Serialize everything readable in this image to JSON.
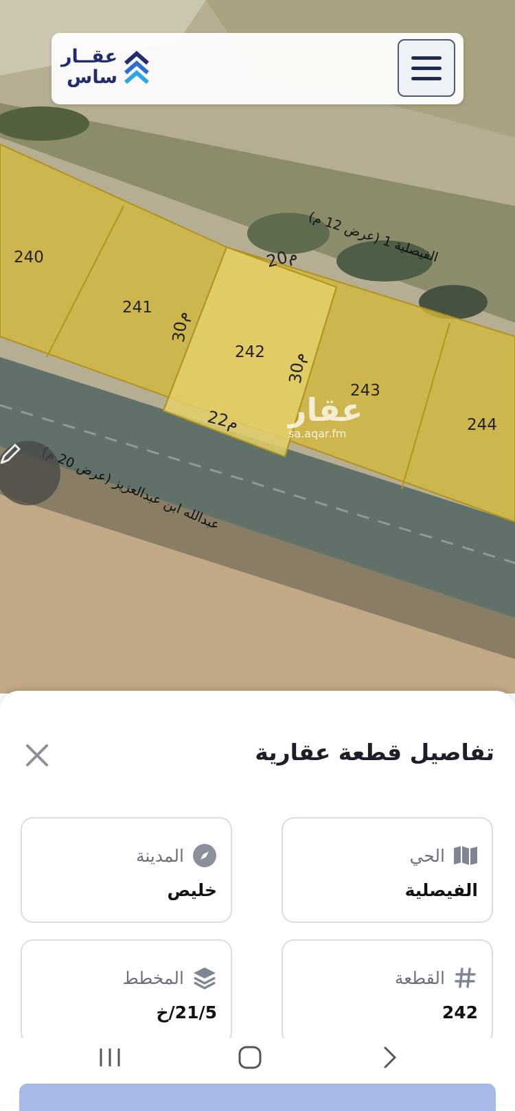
{
  "header": {
    "logo_line1": "عقــار",
    "logo_line2": "ساس",
    "menu_label": "menu"
  },
  "map": {
    "parcels": [
      {
        "number": "240"
      },
      {
        "number": "241"
      },
      {
        "number": "242"
      },
      {
        "number": "243"
      },
      {
        "number": "244"
      }
    ],
    "dimensions": [
      "20م",
      "30م",
      "30م",
      "22م"
    ],
    "streets": [
      {
        "name": "الفيصلية 1 (عرض 12 م)"
      },
      {
        "name": "عبدالله ابن عبدالعزيز (عرض 20 م)"
      }
    ],
    "watermark": {
      "brand": "عقار",
      "url": "sa.aqar.fm"
    },
    "fab_icon": "pencil-icon",
    "colors": {
      "parcel_fill": "#d4b93a",
      "parcel_selected": "#e3cf6a",
      "parcel_border": "#b0931c"
    }
  },
  "sheet": {
    "title": "تفاصيل قطعة عقارية",
    "close_icon": "close-icon",
    "cards": [
      {
        "id": "district",
        "icon": "map-icon",
        "label": "الحي",
        "value": "الفيصلية"
      },
      {
        "id": "city",
        "icon": "compass-icon",
        "label": "المدينة",
        "value": "خليص"
      },
      {
        "id": "parcel",
        "icon": "hash-icon",
        "label": "القطعة",
        "value": "242"
      },
      {
        "id": "plan",
        "icon": "layers-icon",
        "label": "المخطط",
        "value": "21/5/خ"
      }
    ]
  },
  "navbar": {
    "items": [
      "recent-apps-icon",
      "home-icon",
      "back-icon"
    ]
  },
  "colors": {
    "brand_navy": "#1f2c6f",
    "brand_blue": "#2aa8e0",
    "button_blue": "#a7b9e6"
  }
}
